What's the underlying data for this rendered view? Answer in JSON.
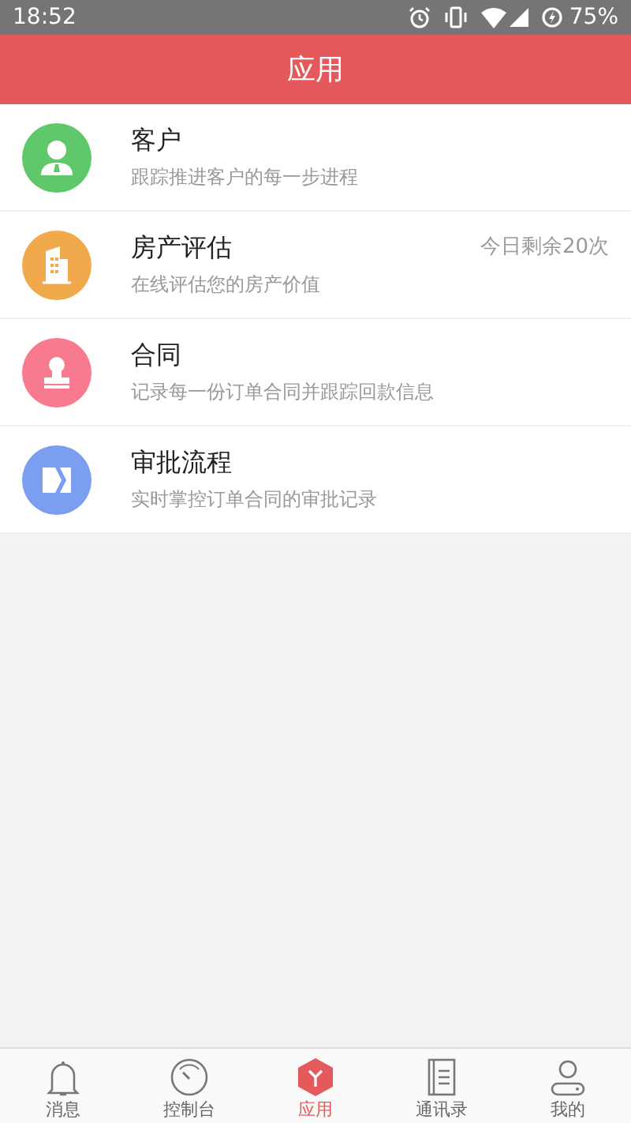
{
  "status_bar": {
    "time": "18:52",
    "battery": "75%"
  },
  "header": {
    "title": "应用"
  },
  "items": [
    {
      "kind": "person",
      "color": "#5ec86a",
      "title": "客户",
      "subtitle": "跟踪推进客户的每一步进程"
    },
    {
      "kind": "building",
      "color": "#f0aa4c",
      "title": "房产评估",
      "subtitle": "在线评估您的房产价值",
      "note": "今日剩余20次"
    },
    {
      "kind": "stamp",
      "color": "#f77a8f",
      "title": "合同",
      "subtitle": "记录每一份订单合同并跟踪回款信息"
    },
    {
      "kind": "flow",
      "color": "#7b9ef0",
      "title": "审批流程",
      "subtitle": "实时掌控订单合同的审批记录"
    }
  ],
  "tabs": [
    {
      "kind": "bell",
      "label": "消息",
      "selected": false
    },
    {
      "kind": "gauge",
      "label": "控制台",
      "selected": false
    },
    {
      "kind": "cube",
      "label": "应用",
      "selected": true
    },
    {
      "kind": "book",
      "label": "通讯录",
      "selected": false
    },
    {
      "kind": "user",
      "label": "我的",
      "selected": false
    }
  ]
}
